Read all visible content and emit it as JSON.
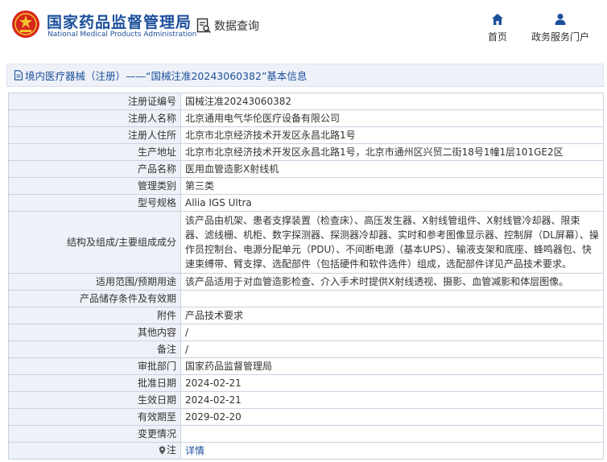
{
  "header": {
    "brand_cn": "国家药品监督管理局",
    "brand_en": "National Medical Products Administration",
    "data_query": "数据查询",
    "nav_home": "首页",
    "nav_portal": "政务服务门户",
    "brand_color": "#1c4f9c",
    "logo_color": "#d7261c"
  },
  "breadcrumb": "境内医疗器械（注册）——“国械注准20243060382”基本信息",
  "rows": [
    {
      "label": "注册证编号",
      "value": "国械注准20243060382"
    },
    {
      "label": "注册人名称",
      "value": "北京通用电气华伦医疗设备有限公司"
    },
    {
      "label": "注册人住所",
      "value": "北京市北京经济技术开发区永昌北路1号"
    },
    {
      "label": "生产地址",
      "value": "北京市北京经济技术开发区永昌北路1号，北京市通州区兴贸二街18号1幢1层101GE2区"
    },
    {
      "label": "产品名称",
      "value": "医用血管造影X射线机"
    },
    {
      "label": "管理类别",
      "value": "第三类"
    },
    {
      "label": "型号规格",
      "value": "Allia IGS Ultra"
    },
    {
      "label": "结构及组成/主要组成成分",
      "value": "该产品由机架、患者支撑装置（检查床）、高压发生器、X射线管组件、X射线管冷却器、限束器、滤线栅、机柜、数字探测器、探测器冷却器、实时和参考图像显示器、控制屏（DL屏幕）、操作员控制台、电源分配单元（PDU）、不间断电源（基本UPS）、输液支架和底座、蜂鸣器包、快速束缚带、臂支撑、选配部件（包括硬件和软件选件）组成，选配部件详见产品技术要求。"
    },
    {
      "label": "适用范围/预期用途",
      "value": "该产品适用于对血管造影检查、介入手术时提供X射线透视、摄影、血管减影和体层图像。"
    },
    {
      "label": "产品储存条件及有效期",
      "value": ""
    },
    {
      "label": "附件",
      "value": "产品技术要求"
    },
    {
      "label": "其他内容",
      "value": "/"
    },
    {
      "label": "备注",
      "value": "/"
    },
    {
      "label": "审批部门",
      "value": "国家药品监督管理局"
    },
    {
      "label": "批准日期",
      "value": "2024-02-21"
    },
    {
      "label": "生效日期",
      "value": "2024-02-21"
    },
    {
      "label": "有效期至",
      "value": "2029-02-20"
    },
    {
      "label": "变更情况",
      "value": ""
    },
    {
      "label": "注",
      "value": "详情"
    }
  ]
}
